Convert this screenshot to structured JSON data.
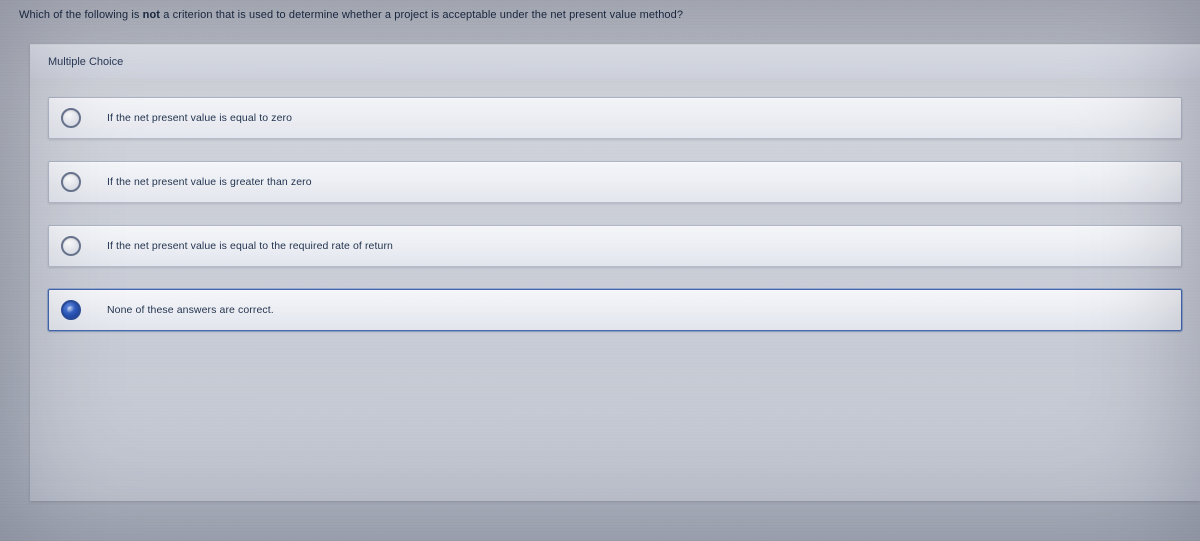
{
  "question": {
    "prefix": "Which of the following is ",
    "emphasis": "not",
    "suffix": " a criterion that is used to determine whether a project is acceptable under the net present value method?"
  },
  "section_title": "Multiple Choice",
  "options": [
    {
      "label": "If the net present value is equal to zero",
      "selected": false
    },
    {
      "label": "If the net present value is greater than zero",
      "selected": false
    },
    {
      "label": "If the net present value is equal to the required rate of return",
      "selected": false
    },
    {
      "label": "None of these answers are correct.",
      "selected": true
    }
  ]
}
